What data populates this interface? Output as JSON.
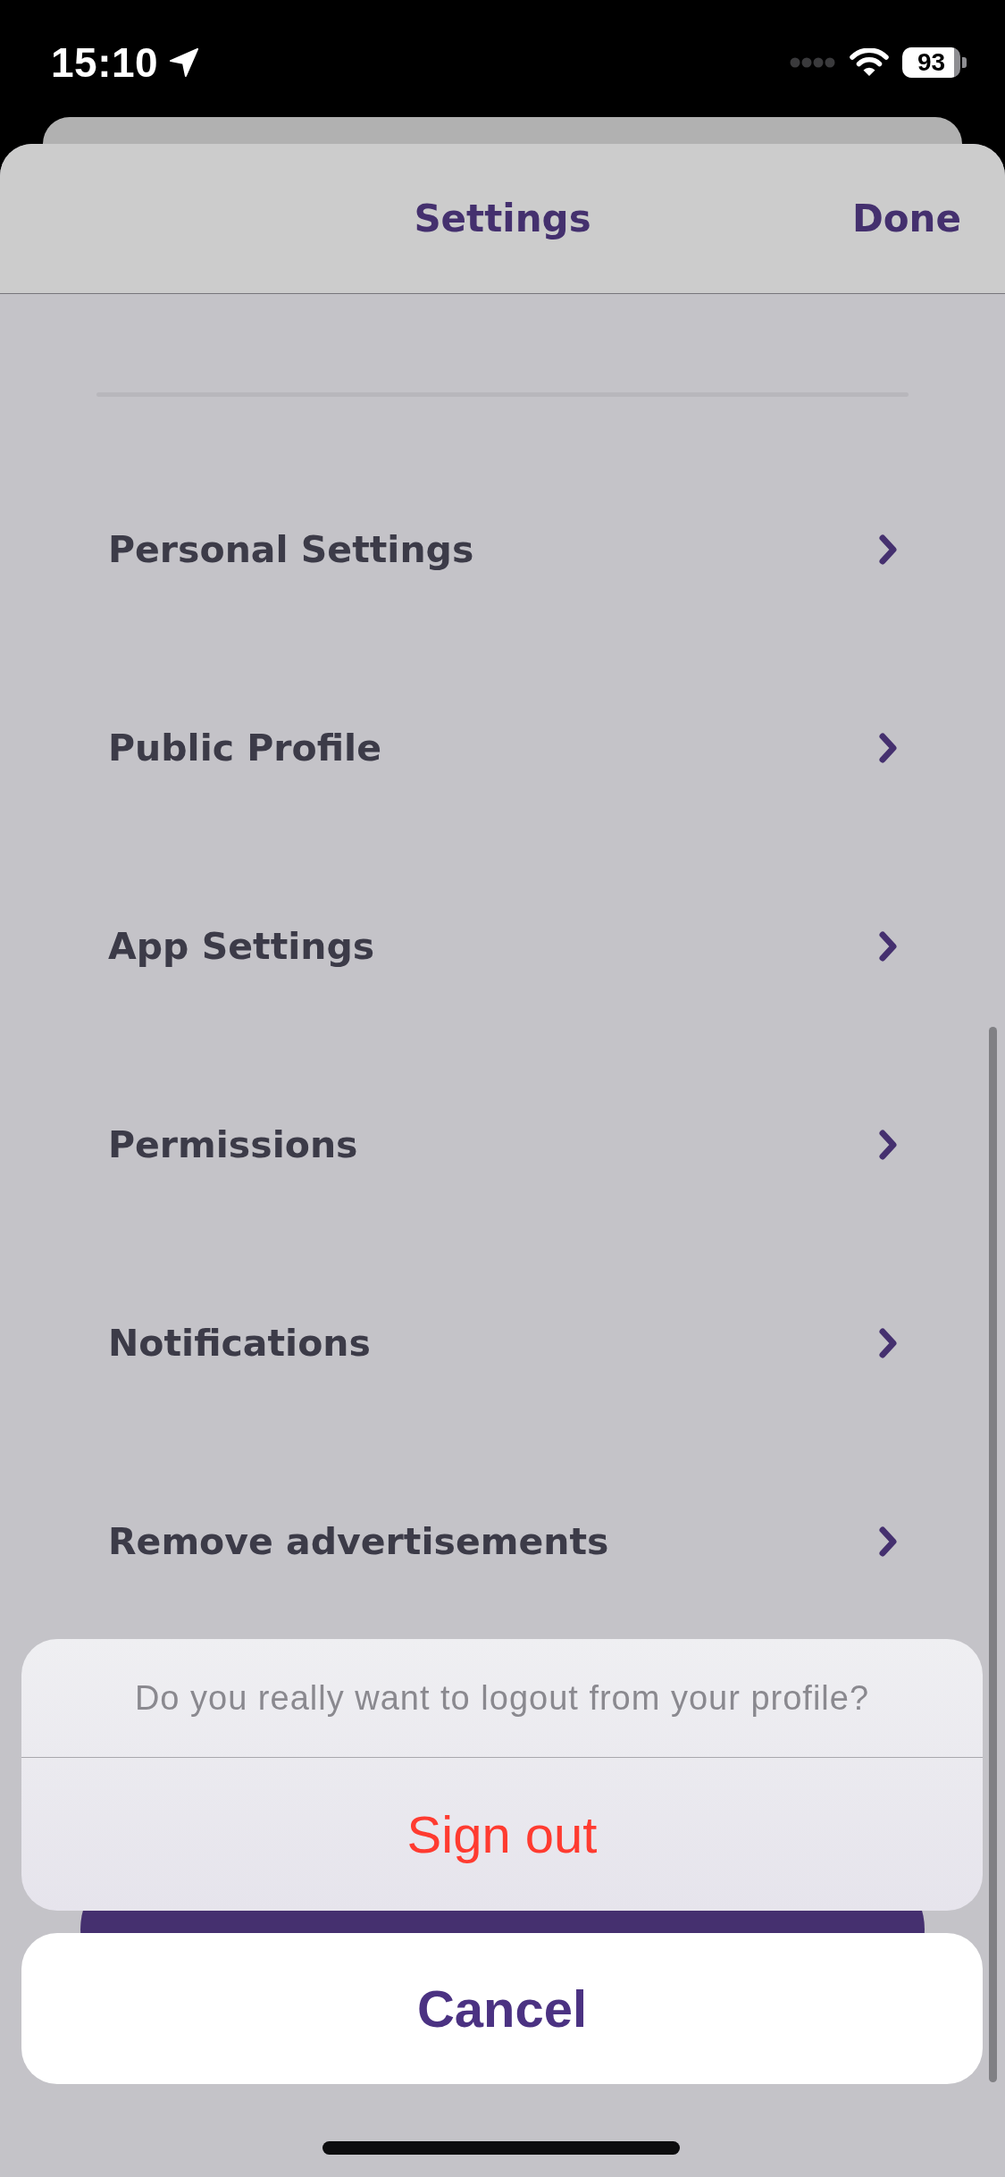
{
  "status_bar": {
    "time": "15:10",
    "battery": "93"
  },
  "sheet": {
    "title": "Settings",
    "done_button": "Done"
  },
  "menu_items": [
    "Personal Settings",
    "Public Profile",
    "App Settings",
    "Permissions",
    "Notifications",
    "Remove advertisements"
  ],
  "action_sheet": {
    "message": "Do you really want to logout from your profile?",
    "actions": [
      {
        "label": "Sign out",
        "kind": "destructive"
      }
    ],
    "cancel": "Cancel"
  }
}
